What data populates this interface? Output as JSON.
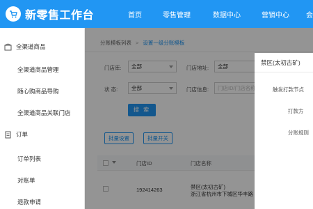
{
  "header": {
    "title": "新零售工作台",
    "nav": [
      "首页",
      "零售管理",
      "数据中心",
      "营销中心",
      "会"
    ]
  },
  "sidebar": {
    "groups": [
      {
        "label": "全渠道商品",
        "items": [
          "全渠道商品管理",
          "随心购商品导购",
          "全渠道商品关联门店"
        ]
      },
      {
        "label": "订单",
        "items": [
          "订单列表",
          "对账单",
          "退款申请"
        ]
      }
    ]
  },
  "breadcrumb": {
    "parent": "分账模板列表",
    "current": "设置一级分账模板"
  },
  "filters": {
    "store_type_label": "门店库:",
    "store_type_value": "全部",
    "address_label": "门店地址:",
    "address_value": "全部",
    "status_label": "状  态:",
    "status_value": "全部",
    "info_label": "门店信息:",
    "info_placeholder": "门店ID/门店名称",
    "search_button": "搜 索"
  },
  "actions": {
    "batch_settings": "批量设置",
    "batch_toggle": "批量开关"
  },
  "table": {
    "headers": [
      "门店ID",
      "门店名称"
    ],
    "rows": [
      {
        "id": "192414263",
        "name": "禁区(太初古矿)",
        "address": "浙江省杭州市下城区华丰路"
      }
    ]
  },
  "drawer": {
    "title": "禁区(太初古矿)",
    "fields": [
      "触发打款节点",
      "打款方",
      "分账规则"
    ]
  },
  "colors": {
    "primary": "#2196f3"
  }
}
